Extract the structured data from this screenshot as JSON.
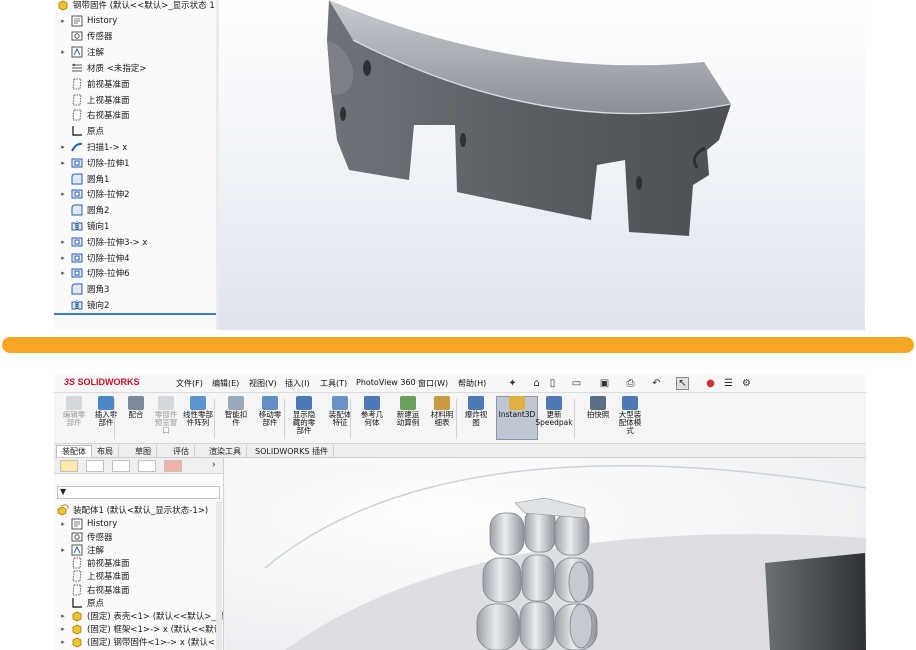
{
  "top_tree": {
    "part_title": "钢带固件 (默认<<默认>_显示状态 1",
    "items": [
      {
        "label": "History",
        "icon": "history-icon",
        "arrow": true
      },
      {
        "label": "传感器",
        "icon": "sensor-icon",
        "arrow": false
      },
      {
        "label": "注解",
        "icon": "annotation-icon",
        "arrow": true
      },
      {
        "label": "材质 <未指定>",
        "icon": "material-icon",
        "arrow": false
      },
      {
        "label": "前视基准面",
        "icon": "plane-icon",
        "arrow": false
      },
      {
        "label": "上视基准面",
        "icon": "plane-icon",
        "arrow": false
      },
      {
        "label": "右视基准面",
        "icon": "plane-icon",
        "arrow": false
      },
      {
        "label": "原点",
        "icon": "origin-icon",
        "arrow": false
      },
      {
        "label": "扫描1-> x",
        "icon": "sweep-icon",
        "arrow": true
      },
      {
        "label": "切除-拉伸1",
        "icon": "cut-extrude-icon",
        "arrow": true
      },
      {
        "label": "圆角1",
        "icon": "fillet-icon",
        "arrow": false
      },
      {
        "label": "切除-拉伸2",
        "icon": "cut-extrude-icon",
        "arrow": true
      },
      {
        "label": "圆角2",
        "icon": "fillet-icon",
        "arrow": false
      },
      {
        "label": "镜向1",
        "icon": "mirror-icon",
        "arrow": false
      },
      {
        "label": "切除-拉伸3-> x",
        "icon": "cut-extrude-icon",
        "arrow": true
      },
      {
        "label": "切除-拉伸4",
        "icon": "cut-extrude-icon",
        "arrow": true
      },
      {
        "label": "切除-拉伸6",
        "icon": "cut-extrude-icon",
        "arrow": true
      },
      {
        "label": "圆角3",
        "icon": "fillet-icon",
        "arrow": false
      },
      {
        "label": "镜向2",
        "icon": "mirror-icon",
        "arrow": false
      }
    ]
  },
  "app": {
    "logo": "SOLIDWORKS",
    "logo_prefix": "3S",
    "menu": [
      "文件(F)",
      "编辑(E)",
      "视图(V)",
      "插入(I)",
      "工具(T)",
      "PhotoView 360",
      "窗口(W)",
      "帮助(H)"
    ]
  },
  "ribbon": {
    "buttons": [
      {
        "label": "编辑零\n部件",
        "disabled": true
      },
      {
        "label": "插入零\n部件",
        "disabled": false
      },
      {
        "label": "配合",
        "disabled": false
      },
      {
        "label": "零部件\n预览窗\n口",
        "disabled": true
      },
      {
        "label": "线性零部\n件阵列",
        "disabled": false
      },
      {
        "label": "智能扣\n件",
        "disabled": false
      },
      {
        "label": "移动零\n部件",
        "disabled": false
      },
      {
        "label": "显示隐\n藏的零\n部件",
        "disabled": false
      },
      {
        "label": "装配体\n特征",
        "disabled": false
      },
      {
        "label": "参考几\n何体",
        "disabled": false
      },
      {
        "label": "新建运\n动算例",
        "disabled": false
      },
      {
        "label": "材料明\n细表",
        "disabled": false
      },
      {
        "label": "爆炸视\n图",
        "disabled": false
      },
      {
        "label": "Instant3D",
        "disabled": false
      },
      {
        "label": "更新\nSpeedpak",
        "disabled": false
      },
      {
        "label": "拍快照",
        "disabled": false
      },
      {
        "label": "大型装\n配体模\n式",
        "disabled": false
      }
    ]
  },
  "tabs": [
    "装配体",
    "布局",
    "草图",
    "评估",
    "渲染工具",
    "SOLIDWORKS 插件"
  ],
  "bottom_tree": {
    "assembly_title": "装配体1 (默认<默认_显示状态-1>)",
    "items": [
      {
        "label": "History",
        "icon": "history-icon",
        "arrow": true
      },
      {
        "label": "传感器",
        "icon": "sensor-icon",
        "arrow": false
      },
      {
        "label": "注解",
        "icon": "annotation-icon",
        "arrow": true
      },
      {
        "label": "前视基准面",
        "icon": "plane-icon",
        "arrow": false
      },
      {
        "label": "上视基准面",
        "icon": "plane-icon",
        "arrow": false
      },
      {
        "label": "右视基准面",
        "icon": "plane-icon",
        "arrow": false
      },
      {
        "label": "原点",
        "icon": "origin-icon",
        "arrow": false
      },
      {
        "label": "(固定) 表壳<1> (默认<<默认>_显",
        "icon": "component-icon",
        "arrow": true
      },
      {
        "label": "(固定) 框架<1>-> x (默认<<默认:",
        "icon": "component-icon",
        "arrow": true
      },
      {
        "label": "(固定) 钢带固件<1>-> x (默认<<I",
        "icon": "component-icon",
        "arrow": true
      }
    ]
  },
  "colors": {
    "divider": "#f6a623",
    "accent": "#3a7bd5",
    "part_gray": "#5f6166",
    "logo_red": "#c8102e"
  }
}
